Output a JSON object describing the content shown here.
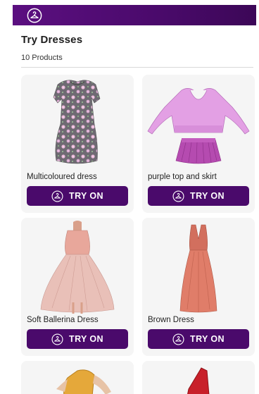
{
  "header": {
    "logo_icon": "hanger-icon"
  },
  "page": {
    "title": "Try Dresses",
    "count": "10 Products"
  },
  "products": [
    {
      "name": "Multicoloured dress",
      "button": "TRY ON"
    },
    {
      "name": "purple top and skirt",
      "button": "TRY ON"
    },
    {
      "name": "Soft Ballerina Dress",
      "button": "TRY ON"
    },
    {
      "name": "Brown Dress",
      "button": "TRY ON"
    }
  ],
  "colors": {
    "brand": "#4a0a6b",
    "card_bg": "#f5f5f5"
  }
}
